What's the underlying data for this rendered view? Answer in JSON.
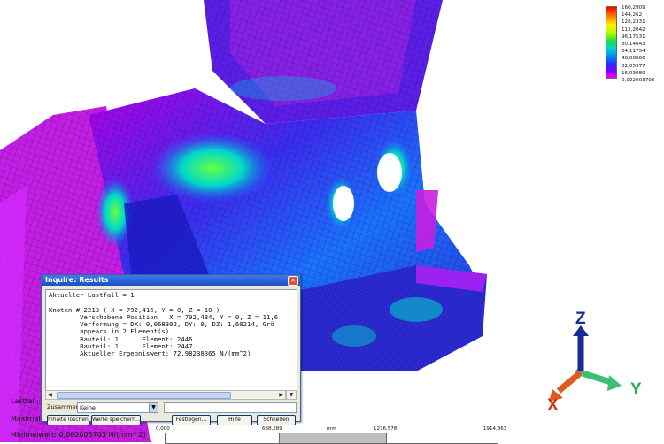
{
  "legend": {
    "values": [
      "160,2909",
      "144,262",
      "128,2331",
      "112,2042",
      "96,17531",
      "80,14643",
      "64,11754",
      "48,08866",
      "32,05977",
      "16,03089",
      "0,002003703"
    ]
  },
  "axes": {
    "z": "Z",
    "x": "X",
    "y": "Y"
  },
  "dialog": {
    "title": "Inquire: Results",
    "close": "×",
    "lines": [
      "Aktueller Lastfall = 1",
      "",
      "Knoten # 2213 ( X = 792,416, Y = 0, Z = 10 )",
      "        Verschobene Position   X = 792,484, Y = 0, Z = 11,6",
      "        Verformung = DX: 0,068302, DY: 0, DZ: 1,60214, Grö",
      "        appears in 2 Element(s)",
      "        Bauteil: 1      Element: 2446",
      "        Bauteil: 1      Element: 2447",
      "        Aktueller Ergebniswert: 72,98238365 N/(mm^2)"
    ],
    "combine_label": "Zusammen",
    "combine_value": "Keine",
    "buttons": {
      "clear": "Inhalte löschen",
      "save": "Werte speichern...",
      "fix": "Festlegen...",
      "help": "Hilfe",
      "close": "Schließen"
    }
  },
  "status": {
    "lastfall": "Lastfall:",
    "maximalwert": "Maximalw",
    "minimalwert": "Minimalwert: 0,002003703 N/(mm^2)"
  },
  "ruler": {
    "ticks": [
      "0,000",
      "638,289",
      "mm",
      "1276,578",
      "1914,863"
    ]
  },
  "colors": {
    "mesh_magenta": "#c81ee0",
    "mesh_blue": "#2a2ad8",
    "mesh_cyan": "#00c8d8",
    "dialog_title": "#245edb"
  }
}
